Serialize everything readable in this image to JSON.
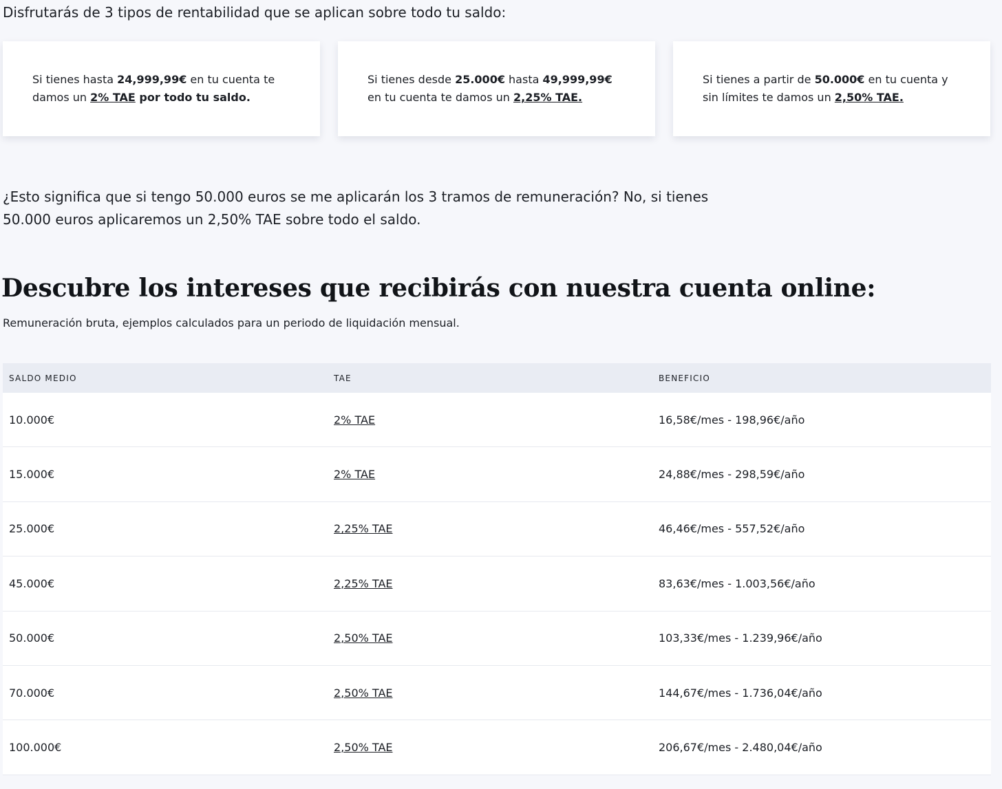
{
  "intro_text": "Disfrutarás de 3 tipos de rentabilidad que se aplican sobre todo tu saldo:",
  "cards": [
    {
      "p1": "Si tienes hasta ",
      "b1": "24,999,99€",
      "p2": " en tu cuenta te damos un ",
      "link": "2% TAE",
      "b2": " por todo tu saldo."
    },
    {
      "p1": "Si tienes desde ",
      "b1": "25.000€",
      "p2": " hasta ",
      "b2": "49,999,99€",
      "p3": " en tu cuenta te damos un ",
      "link": "2,25% TAE."
    },
    {
      "p1": "Si tienes a partir de ",
      "b1": "50.000€",
      "p2": " en tu cuenta y sin límites te damos un ",
      "link": "2,50% TAE."
    }
  ],
  "question_text": "¿Esto significa que si tengo 50.000 euros se me aplicarán los 3 tramos de remuneración? No, si tienes 50.000 euros aplicaremos un 2,50% TAE sobre todo el saldo.",
  "heading": {
    "part1": "Descubre los ",
    "bold1": "intereses que recibirás",
    "part2": " con nuestra ",
    "bold2": "cuenta online:"
  },
  "subtitle": "Remuneración bruta, ejemplos calculados para un periodo de liquidación mensual.",
  "table": {
    "headers": [
      "SALDO MEDIO",
      "TAE",
      "BENEFICIO"
    ],
    "rows": [
      {
        "saldo": "10.000€",
        "tae": "2% TAE",
        "beneficio": "16,58€/mes - 198,96€/año"
      },
      {
        "saldo": "15.000€",
        "tae": "2% TAE",
        "beneficio": "24,88€/mes - 298,59€/año"
      },
      {
        "saldo": "25.000€",
        "tae": "2,25% TAE",
        "beneficio": "46,46€/mes - 557,52€/año"
      },
      {
        "saldo": "45.000€",
        "tae": "2,25% TAE",
        "beneficio": "83,63€/mes - 1.003,56€/año"
      },
      {
        "saldo": "50.000€",
        "tae": "2,50% TAE",
        "beneficio": "103,33€/mes - 1.239,96€/año"
      },
      {
        "saldo": "70.000€",
        "tae": "2,50% TAE",
        "beneficio": "144,67€/mes - 1.736,04€/año"
      },
      {
        "saldo": "100.000€",
        "tae": "2,50% TAE",
        "beneficio": "206,67€/mes - 2.480,04€/año"
      }
    ]
  },
  "colors": {
    "page_background": "#f6f7fb",
    "table_header_background": "#e9ecf3",
    "card_background": "#ffffff",
    "text": "#1b1e24"
  }
}
